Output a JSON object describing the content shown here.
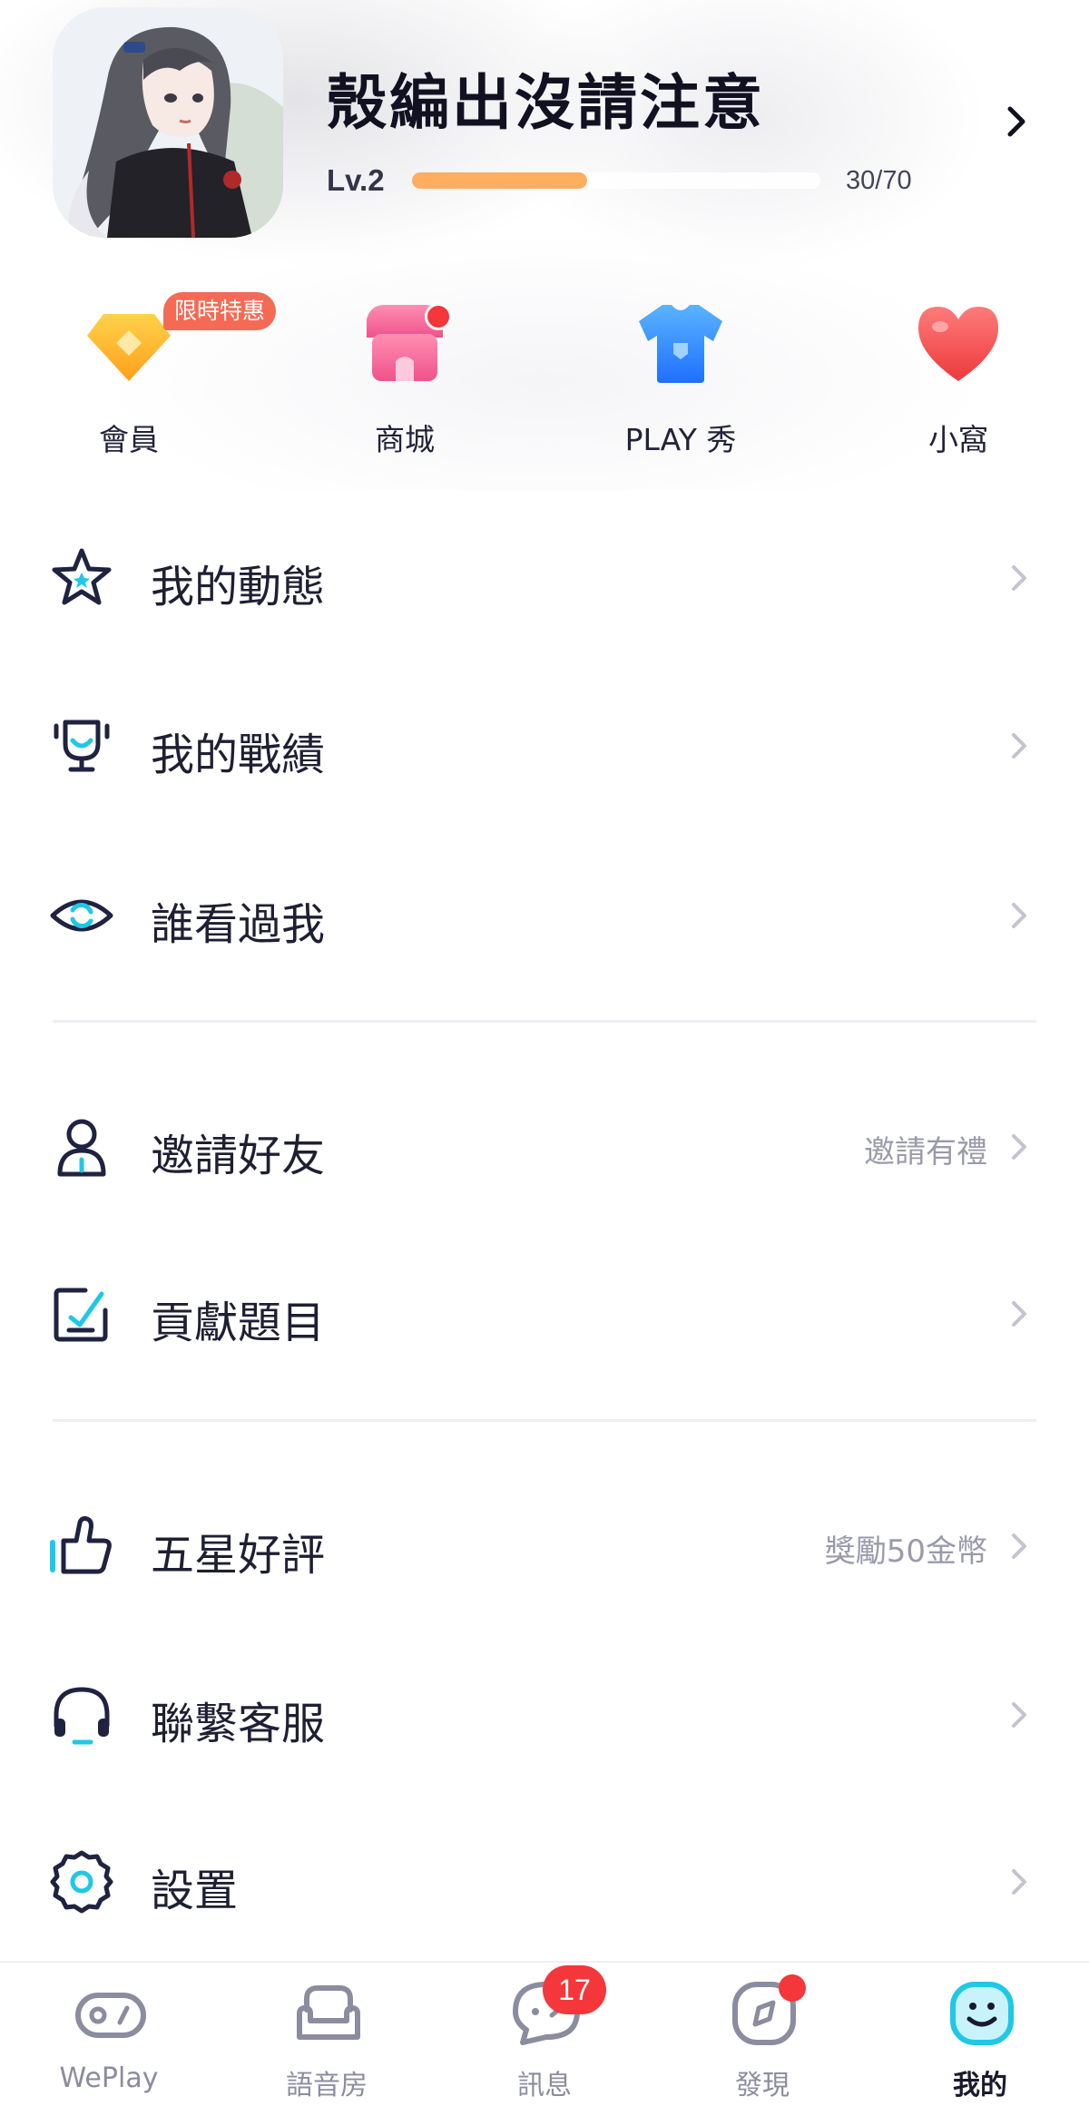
{
  "profile": {
    "username": "殼編出沒請注意",
    "level_label": "Lv.2",
    "xp_current": 30,
    "xp_max": 70,
    "xp_text": "30/70"
  },
  "quick_actions": [
    {
      "label": "會員",
      "icon": "diamond-icon"
    },
    {
      "label": "商城",
      "icon": "shop-icon"
    },
    {
      "label": "PLAY 秀",
      "icon": "tshirt-icon"
    },
    {
      "label": "小窩",
      "icon": "heart-icon"
    }
  ],
  "promo_badge": "限時特惠",
  "menu": [
    {
      "label": "我的動態",
      "icon": "star-icon",
      "extra": ""
    },
    {
      "label": "我的戰績",
      "icon": "trophy-icon",
      "extra": ""
    },
    {
      "label": "誰看過我",
      "icon": "eye-icon",
      "extra": ""
    },
    {
      "label": "邀請好友",
      "icon": "person-icon",
      "extra": "邀請有禮"
    },
    {
      "label": "貢獻題目",
      "icon": "edit-icon",
      "extra": ""
    },
    {
      "label": "五星好評",
      "icon": "thumbs-up-icon",
      "extra": "獎勵50金幣"
    },
    {
      "label": "聯繫客服",
      "icon": "headset-icon",
      "extra": ""
    },
    {
      "label": "設置",
      "icon": "gear-icon",
      "extra": ""
    }
  ],
  "bottom_nav": [
    {
      "label": "WePlay",
      "icon": "gamepad-icon",
      "active": false
    },
    {
      "label": "語音房",
      "icon": "sofa-icon",
      "active": false
    },
    {
      "label": "訊息",
      "icon": "chat-icon",
      "active": false,
      "badge": "17"
    },
    {
      "label": "發現",
      "icon": "compass-icon",
      "active": false
    },
    {
      "label": "我的",
      "icon": "smiley-icon",
      "active": true
    }
  ],
  "colors": {
    "accent": "#1ec8e6",
    "xp_bar": "#ffad5e",
    "badge_red": "#f4373a",
    "promo": "#f46a55",
    "icon_dark": "#1f2340"
  }
}
